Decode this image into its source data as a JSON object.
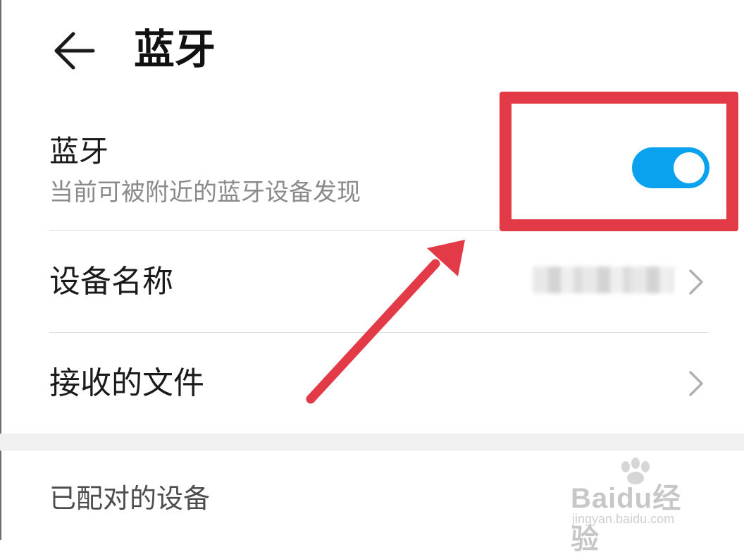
{
  "header": {
    "title": "蓝牙"
  },
  "bluetooth": {
    "title": "蓝牙",
    "subtitle": "当前可被附近的蓝牙设备发现",
    "enabled": true
  },
  "rows": [
    {
      "label": "设备名称"
    },
    {
      "label": "接收的文件"
    }
  ],
  "paired_section": {
    "label": "已配对的设备"
  },
  "watermark": {
    "logo": "Baidu经验",
    "url": "jingyan.baidu.com"
  },
  "colors": {
    "accent": "#0aa1ee",
    "annotation": "#e33a47"
  },
  "icons": [
    "back-arrow-icon",
    "chevron-right-icon",
    "toggle-switch"
  ]
}
